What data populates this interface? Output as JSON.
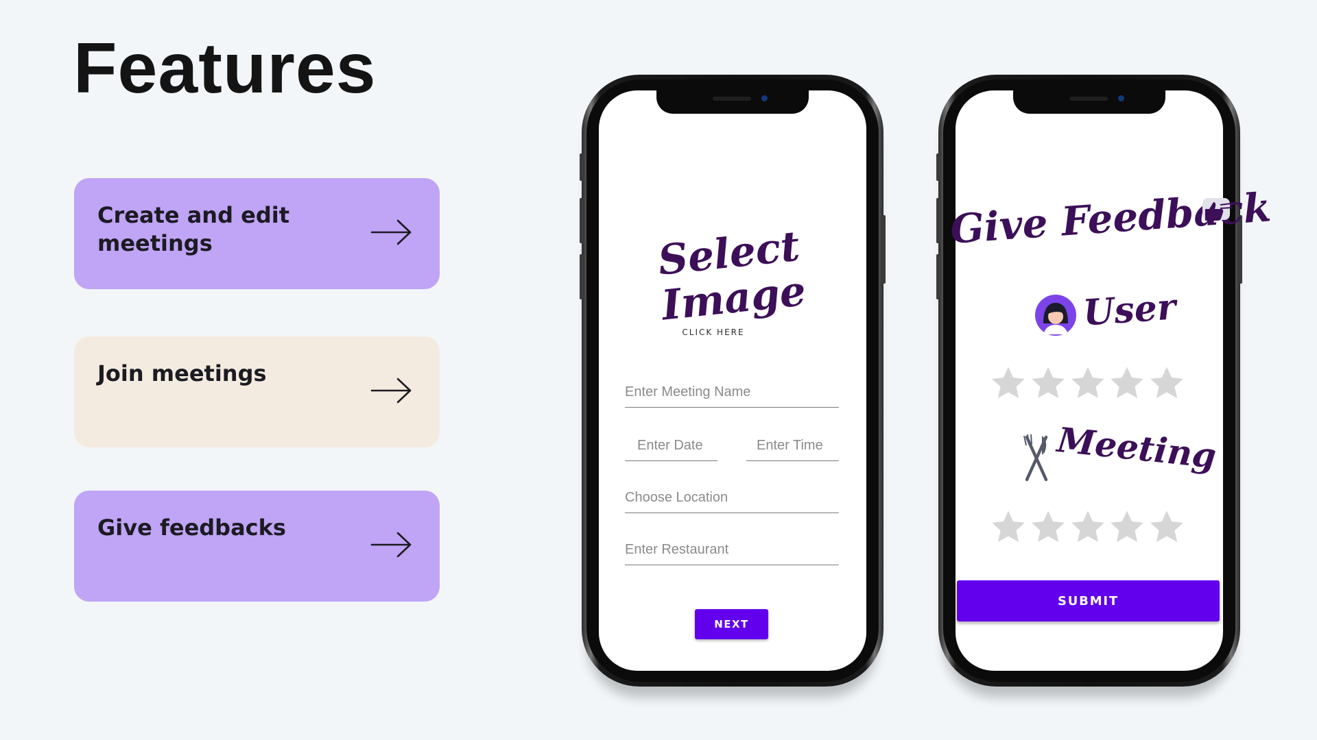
{
  "page": {
    "title": "Features"
  },
  "features": [
    {
      "label": "Create and edit meetings",
      "color": "#c0a4f6"
    },
    {
      "label": "Join meetings",
      "color": "#f4ebe0"
    },
    {
      "label": "Give feedbacks",
      "color": "#c0a4f6"
    }
  ],
  "phone_create": {
    "image_title": "Select Image",
    "image_hint": "CLICK HERE",
    "meeting_name_placeholder": "Enter Meeting Name",
    "date_placeholder": "Enter Date",
    "time_placeholder": "Enter Time",
    "location_placeholder": "Choose Location",
    "restaurant_placeholder": "Enter Restaurant",
    "next_label": "NEXT"
  },
  "phone_feedback": {
    "title": "Give Feedback",
    "user_label": "User",
    "user_rating": 0,
    "meeting_label": "Meeting",
    "meeting_rating": 0,
    "submit_label": "SUBMIT"
  },
  "colors": {
    "accent": "#6200ee",
    "script_text": "#3c0f58",
    "star_empty": "#d6d6d6"
  },
  "icons": [
    "arrow-right-icon",
    "thumbs-up-icon",
    "user-avatar-icon",
    "star-icon",
    "fork-knife-icon"
  ]
}
